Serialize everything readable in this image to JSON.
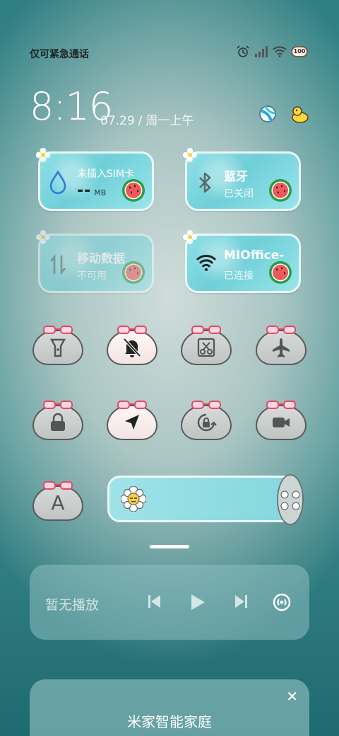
{
  "status_bar": {
    "left_text": "仅可紧急通话",
    "icons": [
      "alarm-icon",
      "signal-icon",
      "wifi-icon"
    ],
    "battery": "100"
  },
  "clock": {
    "time": "8:16",
    "date": "07.29",
    "separator": "/",
    "weekday": "周一上午"
  },
  "tiles": {
    "data": {
      "title": "未插入SIM卡",
      "value": "--",
      "unit": "MB"
    },
    "bluetooth": {
      "title": "蓝牙",
      "status": "已关闭"
    },
    "mobile_data": {
      "title": "移动数据",
      "status": "不可用"
    },
    "wifi": {
      "title": "MIOffice-",
      "status": "已连接"
    }
  },
  "toggles": [
    {
      "name": "flashlight",
      "icon": "flashlight-icon",
      "on": false
    },
    {
      "name": "mute",
      "icon": "bell-off-icon",
      "on": true
    },
    {
      "name": "screenshot",
      "icon": "scissors-icon",
      "on": false
    },
    {
      "name": "airplane",
      "icon": "airplane-icon",
      "on": false
    },
    {
      "name": "lock",
      "icon": "lock-icon",
      "on": false
    },
    {
      "name": "location",
      "icon": "location-icon",
      "on": true
    },
    {
      "name": "auto-rotate",
      "icon": "rotate-lock-icon",
      "on": false
    },
    {
      "name": "screen-record",
      "icon": "video-icon",
      "on": false
    },
    {
      "name": "font",
      "icon": "font-a-icon",
      "on": false
    }
  ],
  "toggle_letter": "A",
  "media": {
    "label": "暂无播放"
  },
  "home_card": {
    "title": "米家智能家庭",
    "close": "✕"
  },
  "colors": {
    "tile": "#7fd6de",
    "bg": "#3e8d8f"
  }
}
